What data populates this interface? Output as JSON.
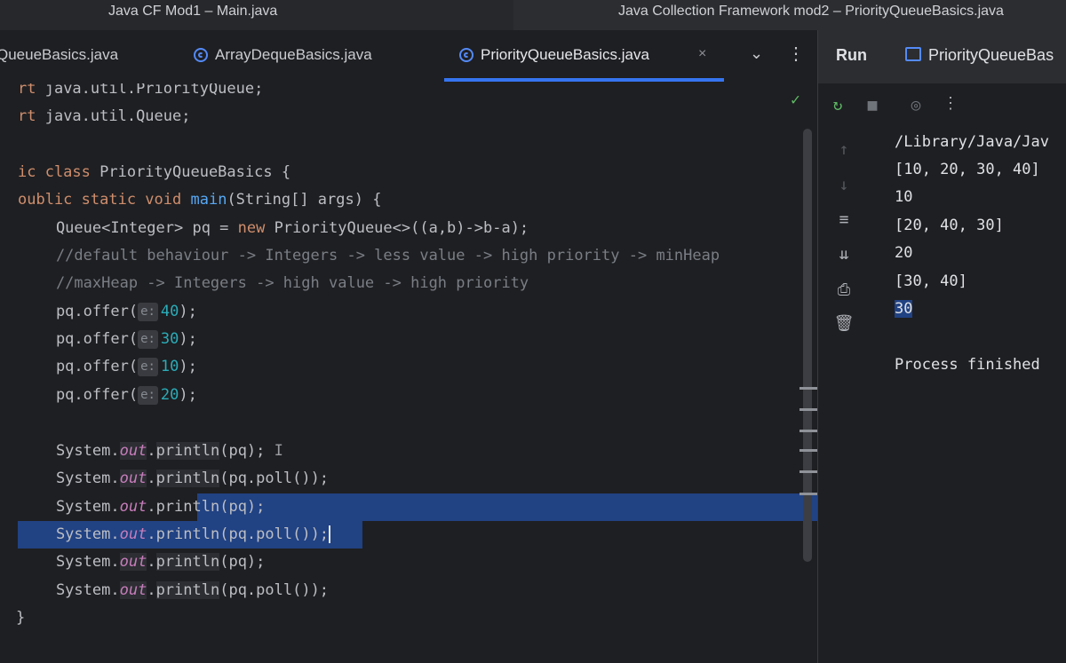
{
  "titlebar": {
    "left_title": "Java CF Mod1 – Main.java",
    "right_title": "Java Collection Framework mod2 – PriorityQueueBasics.java"
  },
  "editor_tabs": [
    {
      "label": "QueueBasics.java",
      "icon": "class-icon",
      "active": false
    },
    {
      "label": "ArrayDequeBasics.java",
      "icon": "class-icon",
      "active": false
    },
    {
      "label": "PriorityQueueBasics.java",
      "icon": "class-icon",
      "active": true
    }
  ],
  "tab_close": "×",
  "tab_chevron": "⌄",
  "tab_more": "⋮",
  "code": {
    "l1_imp": "rt",
    "l1_rest": " java.util.PriorityQueue;",
    "l2_imp": "rt",
    "l2_rest": " java.util.Queue;",
    "l4_kw": "ic class",
    "l4_rest": " PriorityQueueBasics {",
    "l5_kw": "oublic static void",
    "l5_fn": "main",
    "l5_rest": "(String[] args) {",
    "l6_a": "    Queue<Integer> pq = ",
    "l6_new": "new",
    "l6_b": " PriorityQueue<>((a,b)->b-a);",
    "l7_cm": "    //default behaviour -> Integers -> less value -> high priority -> minHeap",
    "l8_cm": "    //maxHeap -> Integers -> high value -> high priority",
    "offer_call": "    pq.offer(",
    "offer_hint": "e:",
    "offer_close": ");",
    "offers": [
      "40",
      "30",
      "10",
      "20"
    ],
    "sys": "    System.",
    "out": "out",
    "dot": ".",
    "println": "println",
    "arg_pq": "(pq);",
    "arg_poll": "(pq.poll());",
    "close_brace": "}"
  },
  "run_panel": {
    "title": "Run",
    "tab_label": "PriorityQueueBas",
    "output_lines": [
      "/Library/Java/Jav",
      "[10, 20, 30, 40]",
      "10",
      "[20, 40, 30]",
      "20",
      "[30, 40]",
      "30",
      "",
      "Process finished"
    ]
  },
  "icons": {
    "rerun": "rerun-icon",
    "stop": "stop-icon",
    "camera": "camera-icon",
    "more": "more-vertical-icon",
    "up": "arrow-up-icon",
    "down": "arrow-down-icon",
    "wrap": "soft-wrap-icon",
    "scroll_end": "scroll-to-end-icon",
    "print": "print-icon",
    "trash": "trash-icon"
  },
  "colors": {
    "accent": "#3574f0",
    "selection": "#214283",
    "keyword": "#cf8e6d",
    "function": "#56a8f5",
    "field": "#c77dbb",
    "number": "#2aacb8",
    "comment": "#7a7e85",
    "check": "#5fb865"
  }
}
